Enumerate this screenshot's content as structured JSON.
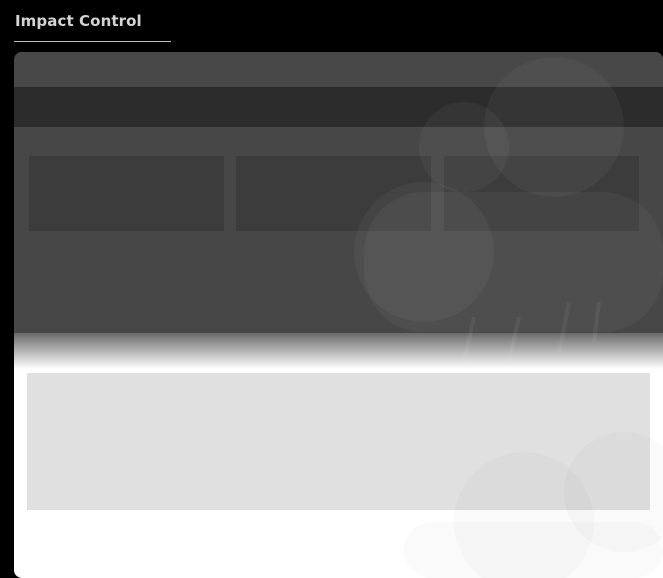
{
  "header": {
    "title": "Impact Control"
  },
  "theme": {
    "background": "#000000",
    "title_color": "#d4d4d4",
    "panel_dark": "#474747",
    "panel_bar": "#2c2c2c",
    "tile": "#3c3c3c",
    "content_block": "#e0e0e0",
    "panel_light": "#ffffff"
  },
  "icons": {
    "watermark": "cloud-icon"
  }
}
